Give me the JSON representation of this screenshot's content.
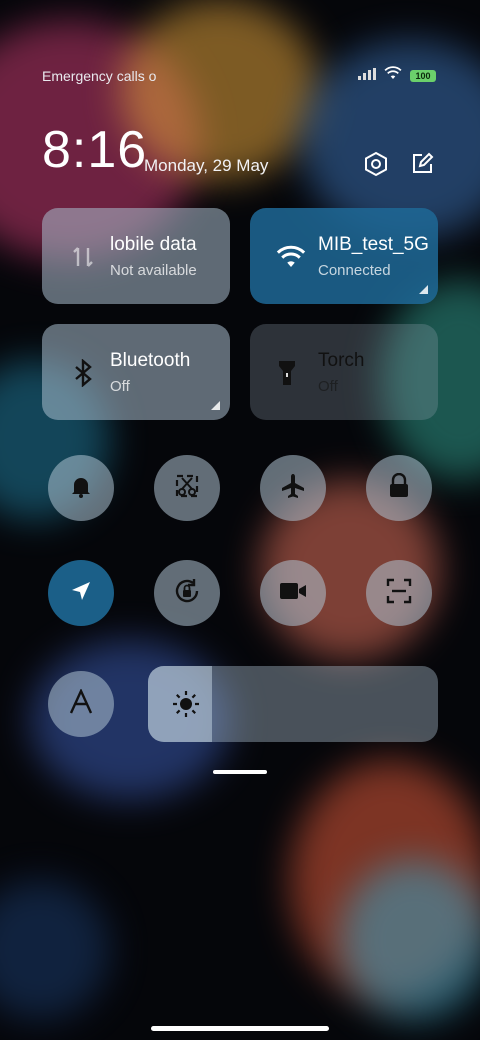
{
  "status_bar": {
    "carrier_text": "Emergency calls o",
    "battery": "100",
    "icons": [
      "signal-icon",
      "wifi-icon",
      "battery-icon"
    ]
  },
  "header": {
    "time": "8:16",
    "date": "Monday, 29 May",
    "settings_icon": "settings-hex-icon",
    "edit_icon": "edit-icon"
  },
  "tiles": [
    {
      "id": "mobile-data",
      "label": "lobile data",
      "sub": "Not available",
      "icon": "mobile-data-icon",
      "state": "inactive"
    },
    {
      "id": "wifi",
      "label": "MIB_test_5G",
      "sub": "Connected",
      "icon": "wifi-icon",
      "state": "active"
    },
    {
      "id": "bluetooth",
      "label": "Bluetooth",
      "sub": "Off",
      "icon": "bluetooth-icon",
      "state": "inactive"
    },
    {
      "id": "torch",
      "label": "Torch",
      "sub": "Off",
      "icon": "torch-icon",
      "state": "faded"
    }
  ],
  "round_buttons": [
    {
      "id": "ring",
      "icon": "bell-icon",
      "active": false
    },
    {
      "id": "screenshot",
      "icon": "scissors-icon",
      "active": false
    },
    {
      "id": "airplane",
      "icon": "airplane-icon",
      "active": false
    },
    {
      "id": "lock",
      "icon": "lock-icon",
      "active": false
    },
    {
      "id": "location",
      "icon": "location-icon",
      "active": true
    },
    {
      "id": "rotation",
      "icon": "rotation-lock-icon",
      "active": false
    },
    {
      "id": "screen-record",
      "icon": "video-camera-icon",
      "active": false
    },
    {
      "id": "scanner",
      "icon": "scan-icon",
      "active": false
    },
    {
      "id": "font",
      "icon": "font-icon",
      "active": false
    }
  ],
  "brightness": {
    "icon": "sun-icon",
    "level": 0.22
  },
  "colors": {
    "accent": "#1e6996",
    "tile": "#aabecd"
  }
}
